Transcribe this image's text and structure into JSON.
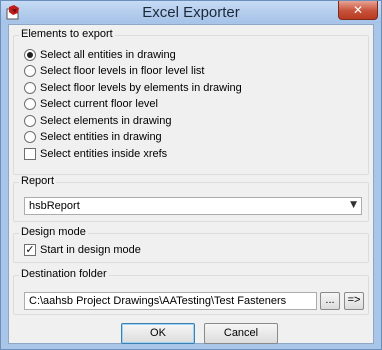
{
  "window": {
    "title": "Excel Exporter",
    "close_label": "✕"
  },
  "elements_group": {
    "label": "Elements to export",
    "options": [
      {
        "label": "Select all entities in drawing",
        "selected": true
      },
      {
        "label": "Select floor levels in floor level list",
        "selected": false
      },
      {
        "label": "Select floor levels by elements in drawing",
        "selected": false
      },
      {
        "label": "Select current floor level",
        "selected": false
      },
      {
        "label": "Select elements in drawing",
        "selected": false
      },
      {
        "label": "Select entities in drawing",
        "selected": false
      }
    ],
    "xrefs_checkbox": {
      "label": "Select entities inside xrefs",
      "checked": false
    }
  },
  "report_group": {
    "label": "Report",
    "selected_value": "hsbReport"
  },
  "design_group": {
    "label": "Design mode",
    "checkbox": {
      "label": "Start in design mode",
      "checked": true
    }
  },
  "destination_group": {
    "label": "Destination folder",
    "path": "C:\\aahsb Project Drawings\\AATesting\\Test Fasteners",
    "browse_label": "...",
    "open_label": "=>"
  },
  "buttons": {
    "ok_label": "OK",
    "cancel_label": "Cancel"
  }
}
